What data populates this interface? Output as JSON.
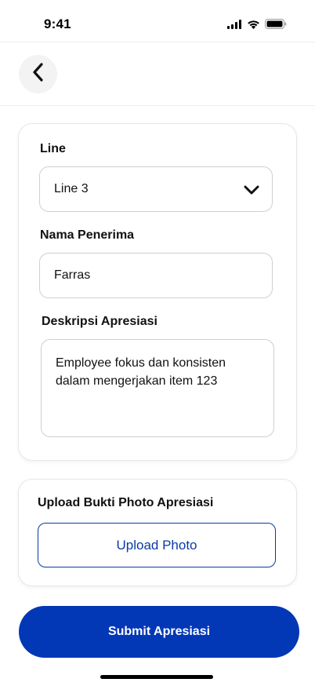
{
  "status_bar": {
    "time": "9:41",
    "icons": [
      "signal-icon",
      "wifi-icon",
      "battery-icon"
    ]
  },
  "nav": {
    "back_icon": "chevron-left-icon"
  },
  "form": {
    "line": {
      "label": "Line",
      "value": "Line 3",
      "icon": "chevron-down-icon"
    },
    "recipient": {
      "label": "Nama Penerima",
      "value": "Farras"
    },
    "description": {
      "label": "Deskripsi Apresiasi",
      "value": "Employee fokus dan konsisten\ndalam mengerjakan item 123"
    }
  },
  "upload": {
    "label": "Upload Bukti Photo Apresiasi",
    "button_label": "Upload Photo"
  },
  "submit": {
    "label": "Submit Apresiasi"
  },
  "colors": {
    "primary": "#0238b6",
    "outline": "#0a3aa8",
    "back_bg": "#f3f3f3"
  }
}
